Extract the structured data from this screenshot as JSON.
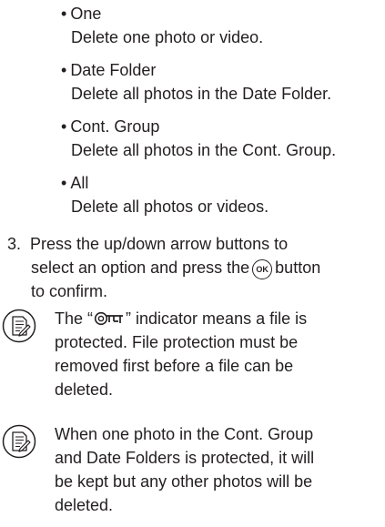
{
  "options": [
    {
      "title": "One",
      "desc": "Delete one photo or video."
    },
    {
      "title": "Date Folder",
      "desc": "Delete all photos in the Date Folder."
    },
    {
      "title": "Cont. Group",
      "desc": "Delete all photos in the Cont. Group."
    },
    {
      "title": "All",
      "desc": "Delete all photos or videos."
    }
  ],
  "step": {
    "number": "3.",
    "line1": "Press the up/down arrow buttons to",
    "line2_before": "select an option and press the",
    "ok_label": "OK",
    "line2_after": "button",
    "line3": "to confirm."
  },
  "note1": {
    "icon": "memo-note-icon",
    "line1_before": "The “",
    "lock_icon": "protected-key-icon",
    "line1_after": "” indicator means a file is",
    "line2": "protected. File protection must be",
    "line3": "removed first before a file can be",
    "line4": "deleted."
  },
  "note2": {
    "icon": "memo-note-icon",
    "line1": "When one photo in the Cont. Group",
    "line2": "and Date Folders is protected, it will",
    "line3": "be kept but any other photos will be",
    "line4": "deleted."
  }
}
